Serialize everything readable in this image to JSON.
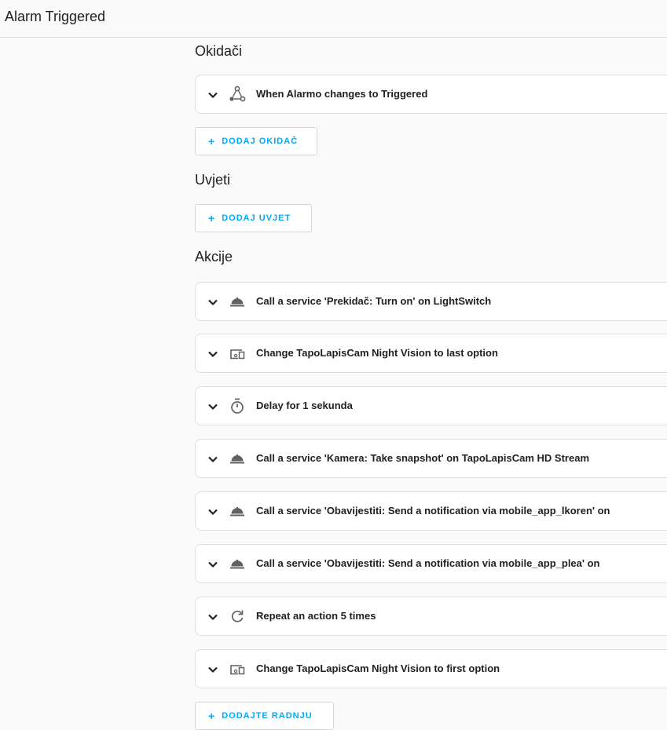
{
  "header": {
    "title": "Alarm Triggered"
  },
  "sections": {
    "triggers": {
      "title": "Okidači",
      "items": [
        {
          "icon": "node-trigger-icon",
          "label": "When Alarmo changes to Triggered"
        }
      ],
      "add_label": "DODAJ OKIDAČ"
    },
    "conditions": {
      "title": "Uvjeti",
      "add_label": "DODAJ UVJET"
    },
    "actions": {
      "title": "Akcije",
      "items": [
        {
          "icon": "room-service-icon",
          "label": "Call a service 'Prekidač: Turn on' on LightSwitch"
        },
        {
          "icon": "devices-icon",
          "label": "Change TapoLapisCam Night Vision to last option"
        },
        {
          "icon": "timer-icon",
          "label": "Delay for 1 sekunda"
        },
        {
          "icon": "room-service-icon",
          "label": "Call a service 'Kamera: Take snapshot' on TapoLapisCam HD Stream"
        },
        {
          "icon": "room-service-icon",
          "label": "Call a service 'Obavijestiti: Send a notification via mobile_app_lkoren' on"
        },
        {
          "icon": "room-service-icon",
          "label": "Call a service 'Obavijestiti: Send a notification via mobile_app_plea' on"
        },
        {
          "icon": "refresh-icon",
          "label": "Repeat an action 5 times"
        },
        {
          "icon": "devices-icon",
          "label": "Change TapoLapisCam Night Vision to first option"
        }
      ],
      "add_label": "DODAJTE RADNJU"
    }
  },
  "colors": {
    "accent": "#03a9f4",
    "icon": "#616161",
    "border": "#e0e0e0"
  }
}
